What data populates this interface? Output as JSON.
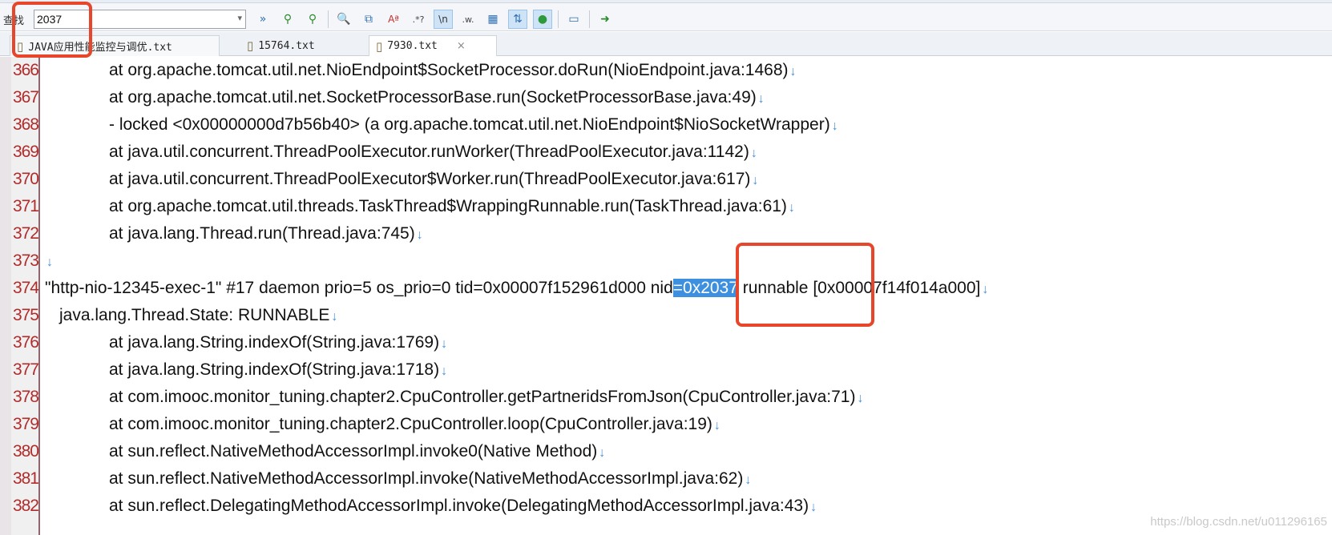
{
  "toolbar": {
    "find_label": "查找",
    "find_value": "2037",
    "icons": [
      "find-next-icon",
      "find-prev-icon",
      "find-all-icon",
      "search-icon",
      "copy-icon",
      "match-case-icon",
      "regex-icon",
      "newline-icon",
      "whole-word-icon",
      "table-icon",
      "sort-icon",
      "globe-icon",
      "window-icon",
      "go-icon"
    ],
    "icon_glyphs": [
      "»",
      "⚲",
      "⚲",
      "🔍",
      "⧉",
      "Aª",
      ".*?",
      "\\n",
      ".w.",
      "▦",
      "⇅",
      "●",
      "▭",
      "➜"
    ]
  },
  "tabs": [
    {
      "label": "JAVA应用性能监控与调优.txt"
    },
    {
      "label": "15764.txt"
    },
    {
      "label": "7930.txt",
      "close": "×"
    }
  ],
  "editor": {
    "lines": [
      {
        "num": "366",
        "text": "at org.apache.tomcat.util.net.NioEndpoint$SocketProcessor.doRun(NioEndpoint.java:1468)"
      },
      {
        "num": "367",
        "text": "at org.apache.tomcat.util.net.SocketProcessorBase.run(SocketProcessorBase.java:49)"
      },
      {
        "num": "368",
        "text": "- locked <0x00000000d7b56b40> (a org.apache.tomcat.util.net.NioEndpoint$NioSocketWrapper)"
      },
      {
        "num": "369",
        "text": "at java.util.concurrent.ThreadPoolExecutor.runWorker(ThreadPoolExecutor.java:1142)"
      },
      {
        "num": "370",
        "text": "at java.util.concurrent.ThreadPoolExecutor$Worker.run(ThreadPoolExecutor.java:617)"
      },
      {
        "num": "371",
        "text": "at org.apache.tomcat.util.threads.TaskThread$WrappingRunnable.run(TaskThread.java:61)"
      },
      {
        "num": "372",
        "text": "at java.lang.Thread.run(Thread.java:745)"
      },
      {
        "num": "373",
        "text": ""
      },
      {
        "num": "374",
        "pre": "\"http-nio-12345-exec-1\" #17 daemon prio=5 os_prio=0 tid=0x00007f152961d000 nid",
        "match": "=0x2037",
        "post": " runnable [0x00007f14f014a000]"
      },
      {
        "num": "375",
        "text": "java.lang.Thread.State: RUNNABLE"
      },
      {
        "num": "376",
        "text": "at java.lang.String.indexOf(String.java:1769)"
      },
      {
        "num": "377",
        "text": "at java.lang.String.indexOf(String.java:1718)"
      },
      {
        "num": "378",
        "text": "at com.imooc.monitor_tuning.chapter2.CpuController.getPartneridsFromJson(CpuController.java:71)"
      },
      {
        "num": "379",
        "text": "at com.imooc.monitor_tuning.chapter2.CpuController.loop(CpuController.java:19)"
      },
      {
        "num": "380",
        "text": "at sun.reflect.NativeMethodAccessorImpl.invoke0(Native Method)"
      },
      {
        "num": "381",
        "text": "at sun.reflect.NativeMethodAccessorImpl.invoke(NativeMethodAccessorImpl.java:62)"
      },
      {
        "num": "382",
        "text": "at sun.reflect.DelegatingMethodAccessorImpl.invoke(DelegatingMethodAccessorImpl.java:43)"
      }
    ],
    "eol_mark": "↓"
  },
  "watermark": "https://blog.csdn.net/u011296165",
  "colors": {
    "line_number": "#b12b2b",
    "selection": "#3d8fe0",
    "annotation": "#e8462a",
    "eol": "#4a8fd8"
  }
}
